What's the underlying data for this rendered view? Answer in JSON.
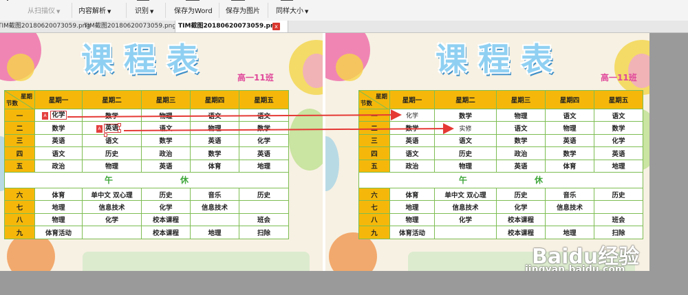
{
  "toolbar": {
    "items": [
      {
        "label": "从扫描仪",
        "enabled": false
      },
      {
        "label": "内容解析",
        "enabled": true
      },
      {
        "label": "识别",
        "enabled": true
      },
      {
        "label": "保存为Word",
        "enabled": true
      },
      {
        "label": "保存为图片",
        "enabled": true
      },
      {
        "label": "同样大小",
        "enabled": true
      }
    ]
  },
  "tabs": [
    {
      "label": "TIM截图20180620073059.png"
    },
    {
      "label": "TIM截图20180620073059.png"
    },
    {
      "label": "TIM截图20180620073059.png",
      "active": true
    }
  ],
  "tab_close": "x",
  "schedule": {
    "title": "课程表",
    "class_label": "高一11班",
    "corner_top": "星期",
    "corner_bottom": "节数",
    "days": [
      "星期一",
      "星期二",
      "星期三",
      "星期四",
      "星期五"
    ],
    "lunch": [
      "午",
      "休"
    ],
    "left_rows": [
      {
        "label": "一",
        "cells": [
          "化学",
          "数学",
          "物理",
          "语文",
          "语文"
        ]
      },
      {
        "label": "二",
        "cells": [
          "数学",
          "英语",
          "语文",
          "物理",
          "数学"
        ]
      },
      {
        "label": "三",
        "cells": [
          "英语",
          "语文",
          "数学",
          "英语",
          "化学"
        ]
      },
      {
        "label": "四",
        "cells": [
          "语文",
          "历史",
          "政治",
          "数学",
          "英语"
        ]
      },
      {
        "label": "五",
        "cells": [
          "政治",
          "物理",
          "英语",
          "体育",
          "地理"
        ]
      },
      {
        "label": "六",
        "cells": [
          "体育",
          "单中文  双心理",
          "历史",
          "音乐",
          "历史"
        ]
      },
      {
        "label": "七",
        "cells": [
          "地理",
          "信息技术",
          "化学",
          "信息技术",
          ""
        ]
      },
      {
        "label": "八",
        "cells": [
          "物理",
          "化学",
          "校本课程",
          "",
          "班会"
        ]
      },
      {
        "label": "九",
        "cells": [
          "体育活动",
          "",
          "校本课程",
          "地理",
          "扫除"
        ]
      }
    ],
    "right_rows": [
      {
        "label": "一",
        "cells": [
          "化学",
          "数学",
          "物理",
          "语文",
          "语文"
        ]
      },
      {
        "label": "二",
        "cells": [
          "数学",
          "实修",
          "语文",
          "物理",
          "数学"
        ]
      },
      {
        "label": "三",
        "cells": [
          "英语",
          "语文",
          "数学",
          "英语",
          "化学"
        ]
      },
      {
        "label": "四",
        "cells": [
          "语文",
          "历史",
          "政治",
          "数学",
          "英语"
        ]
      },
      {
        "label": "五",
        "cells": [
          "政治",
          "物理",
          "英语",
          "体育",
          "地理"
        ]
      },
      {
        "label": "六",
        "cells": [
          "体育",
          "单中文  双心理",
          "历史",
          "音乐",
          "历史"
        ]
      },
      {
        "label": "七",
        "cells": [
          "地理",
          "信息技术",
          "化学",
          "信息技术",
          ""
        ]
      },
      {
        "label": "八",
        "cells": [
          "物理",
          "化学",
          "校本课程",
          "",
          "班会"
        ]
      },
      {
        "label": "九",
        "cells": [
          "体育活动",
          "",
          "校本课程",
          "地理",
          "扫除"
        ]
      }
    ]
  },
  "watermark": {
    "logo": "Baidu经验",
    "url": "jingyan.baidu.com"
  },
  "colors": {
    "header": "#f5b80a",
    "grid": "#7dbd52",
    "arrow": "#e53935",
    "title": "#8fd0f2",
    "class_label": "#e0479a"
  },
  "icons": [
    "pdf-icon",
    "dropdown-caret-icon",
    "close-icon"
  ]
}
